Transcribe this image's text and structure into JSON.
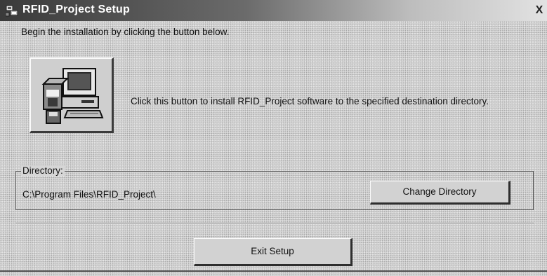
{
  "window": {
    "title": "RFID_Project Setup",
    "close_glyph": "X",
    "title_icon": "setup-app-icon"
  },
  "content": {
    "intro": "Begin the installation by clicking the button below.",
    "install_button": {
      "icon": "computer-install-icon"
    },
    "install_description": "Click this button to install RFID_Project software to the specified destination directory."
  },
  "directory": {
    "legend": "Directory:",
    "path": "C:\\Program Files\\RFID_Project\\",
    "change_button_label": "Change Directory"
  },
  "footer": {
    "exit_button_label": "Exit Setup"
  },
  "colors": {
    "titlebar_dark": "#3a3a3a",
    "dialog_face": "#d6d6d6"
  }
}
